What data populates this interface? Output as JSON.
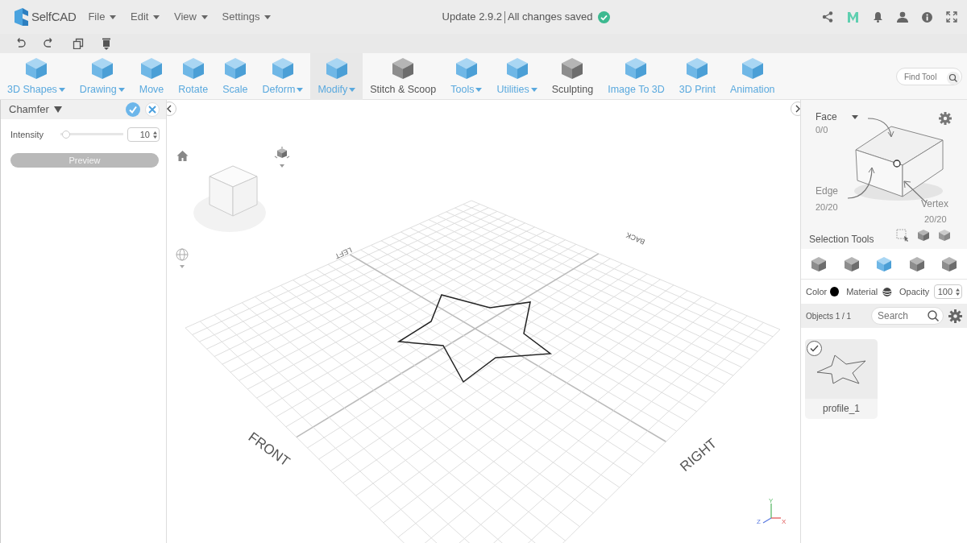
{
  "app": {
    "logo": "SelfCAD",
    "menus": [
      {
        "label": "File"
      },
      {
        "label": "Edit"
      },
      {
        "label": "View"
      },
      {
        "label": "Settings"
      }
    ],
    "version": "Update 2.9.2",
    "save_state": "All changes saved",
    "saved": true
  },
  "toolbar": {
    "tools": [
      {
        "label": "3D Shapes",
        "dropdown": true,
        "selected": false,
        "accent": true
      },
      {
        "label": "Drawing",
        "dropdown": true,
        "selected": false,
        "accent": true
      },
      {
        "label": "Move",
        "dropdown": false,
        "selected": false,
        "accent": true
      },
      {
        "label": "Rotate",
        "dropdown": false,
        "selected": false,
        "accent": true
      },
      {
        "label": "Scale",
        "dropdown": false,
        "selected": false,
        "accent": true
      },
      {
        "label": "Deform",
        "dropdown": true,
        "selected": false,
        "accent": true
      },
      {
        "label": "Modify",
        "dropdown": true,
        "selected": true,
        "accent": true
      },
      {
        "label": "Stitch & Scoop",
        "dropdown": false,
        "selected": false,
        "accent": false
      },
      {
        "label": "Tools",
        "dropdown": true,
        "selected": false,
        "accent": true
      },
      {
        "label": "Utilities",
        "dropdown": true,
        "selected": false,
        "accent": true
      },
      {
        "label": "Sculpting",
        "dropdown": false,
        "selected": false,
        "accent": false
      },
      {
        "label": "Image To 3D",
        "dropdown": false,
        "selected": false,
        "accent": true
      },
      {
        "label": "3D Print",
        "dropdown": false,
        "selected": false,
        "accent": true
      },
      {
        "label": "Animation",
        "dropdown": false,
        "selected": false,
        "accent": true
      }
    ],
    "search": {
      "placeholder": "Find Tool"
    }
  },
  "tool_panel": {
    "title": "Chamfer",
    "params": [
      {
        "label": "Intensity",
        "level": 0.03,
        "value": "10"
      }
    ],
    "preview_button": "Preview"
  },
  "viewport": {
    "directions": {
      "left": "LEFT",
      "back": "BACK",
      "front": "FRONT",
      "right": "RIGHT"
    },
    "axes": {
      "y": "Y",
      "z": "Z",
      "x": "X"
    }
  },
  "selection": {
    "mode": "Face",
    "face_count": "0/0",
    "edge_label": "Edge",
    "edge_count": "20/20",
    "vertex_label": "Vertex",
    "vertex_count": "20/20",
    "tools_label": "Selection Tools"
  },
  "view_modes": [
    {
      "selected": false
    },
    {
      "selected": false
    },
    {
      "selected": true
    },
    {
      "selected": false
    },
    {
      "selected": false
    }
  ],
  "appearance": {
    "color_label": "Color",
    "color": "#000000",
    "material_label": "Material",
    "opacity_label": "Opacity",
    "opacity": "100"
  },
  "objects": {
    "count": "Objects 1 / 1",
    "search_placeholder": "Search",
    "items": [
      {
        "name": "profile_1",
        "checked": true
      }
    ]
  }
}
